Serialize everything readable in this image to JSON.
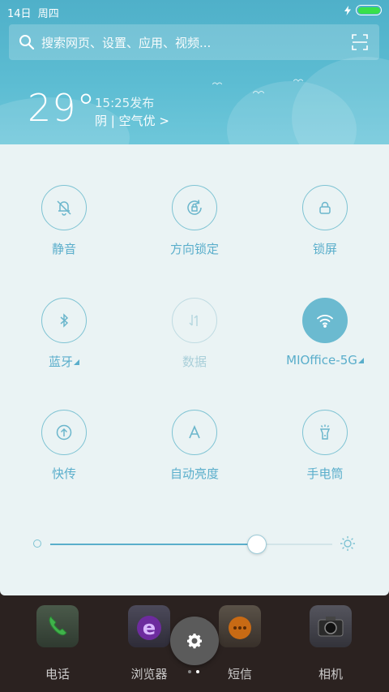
{
  "status_bar": {
    "date": "14日",
    "weekday": "周四"
  },
  "search": {
    "placeholder": "搜索网页、设置、应用、视频..."
  },
  "weather": {
    "temperature": "29°",
    "publish_time": "15:25发布",
    "condition": "阴 | 空气优 >"
  },
  "toggles": [
    {
      "label": "静音",
      "icon": "bell-off-icon",
      "state": "off"
    },
    {
      "label": "方向锁定",
      "icon": "rotation-lock-icon",
      "state": "off"
    },
    {
      "label": "锁屏",
      "icon": "lock-icon",
      "state": "off"
    },
    {
      "label": "蓝牙",
      "icon": "bluetooth-icon",
      "state": "off"
    },
    {
      "label": "数据",
      "icon": "mobile-data-icon",
      "state": "disabled"
    },
    {
      "label": "MIOffice-5G",
      "icon": "wifi-icon",
      "state": "on"
    },
    {
      "label": "快传",
      "icon": "upload-icon",
      "state": "off"
    },
    {
      "label": "自动亮度",
      "icon": "auto-brightness-icon",
      "state": "off"
    },
    {
      "label": "手电筒",
      "icon": "flashlight-icon",
      "state": "off"
    }
  ],
  "brightness": {
    "level": 0.73
  },
  "dock": {
    "apps": [
      {
        "label": "电话",
        "icon": "phone-icon"
      },
      {
        "label": "浏览器",
        "icon": "browser-icon"
      },
      {
        "label": "短信",
        "icon": "messages-icon"
      },
      {
        "label": "相机",
        "icon": "camera-icon"
      }
    ],
    "page_indicator": {
      "pages": 2,
      "current": 2
    }
  },
  "colors": {
    "accent": "#5aaecb",
    "header_bg": "#5dbdd3",
    "panel_bg": "#eaf3f4",
    "active_toggle": "#6bbad0"
  }
}
